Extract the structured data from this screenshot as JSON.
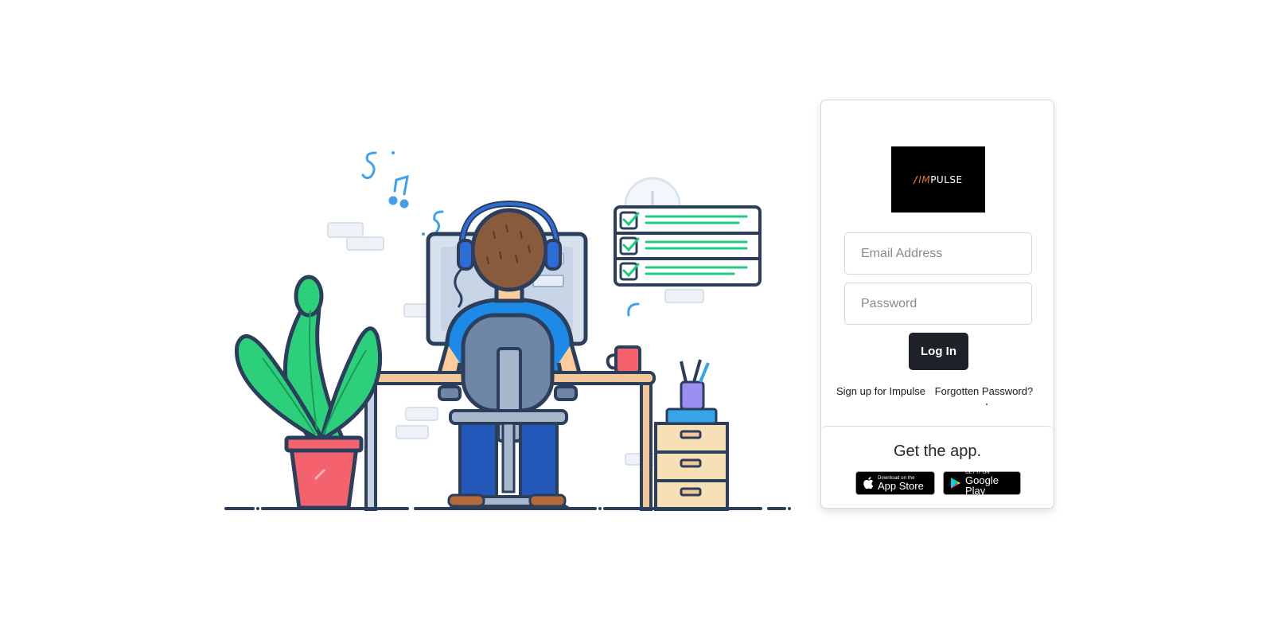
{
  "brand": {
    "logo_text": "IMPULSE",
    "logo_bg": "#000000",
    "accent": "#e87722"
  },
  "login": {
    "email_placeholder": "Email Address",
    "password_placeholder": "Password",
    "login_label": "Log In",
    "login_bg": "#1f2229",
    "signup_label": "Sign up for Impulse",
    "forgot_label": "Forgotten Password?"
  },
  "get_app": {
    "heading": "Get the app.",
    "app_store": {
      "small": "Download on the",
      "big": "App Store",
      "icon": "apple-icon"
    },
    "google_play": {
      "small": "GET IT ON",
      "big": "Google Play",
      "icon": "google-play-icon"
    }
  },
  "illustration": {
    "description_icon": "developer-at-desk-illustration"
  }
}
